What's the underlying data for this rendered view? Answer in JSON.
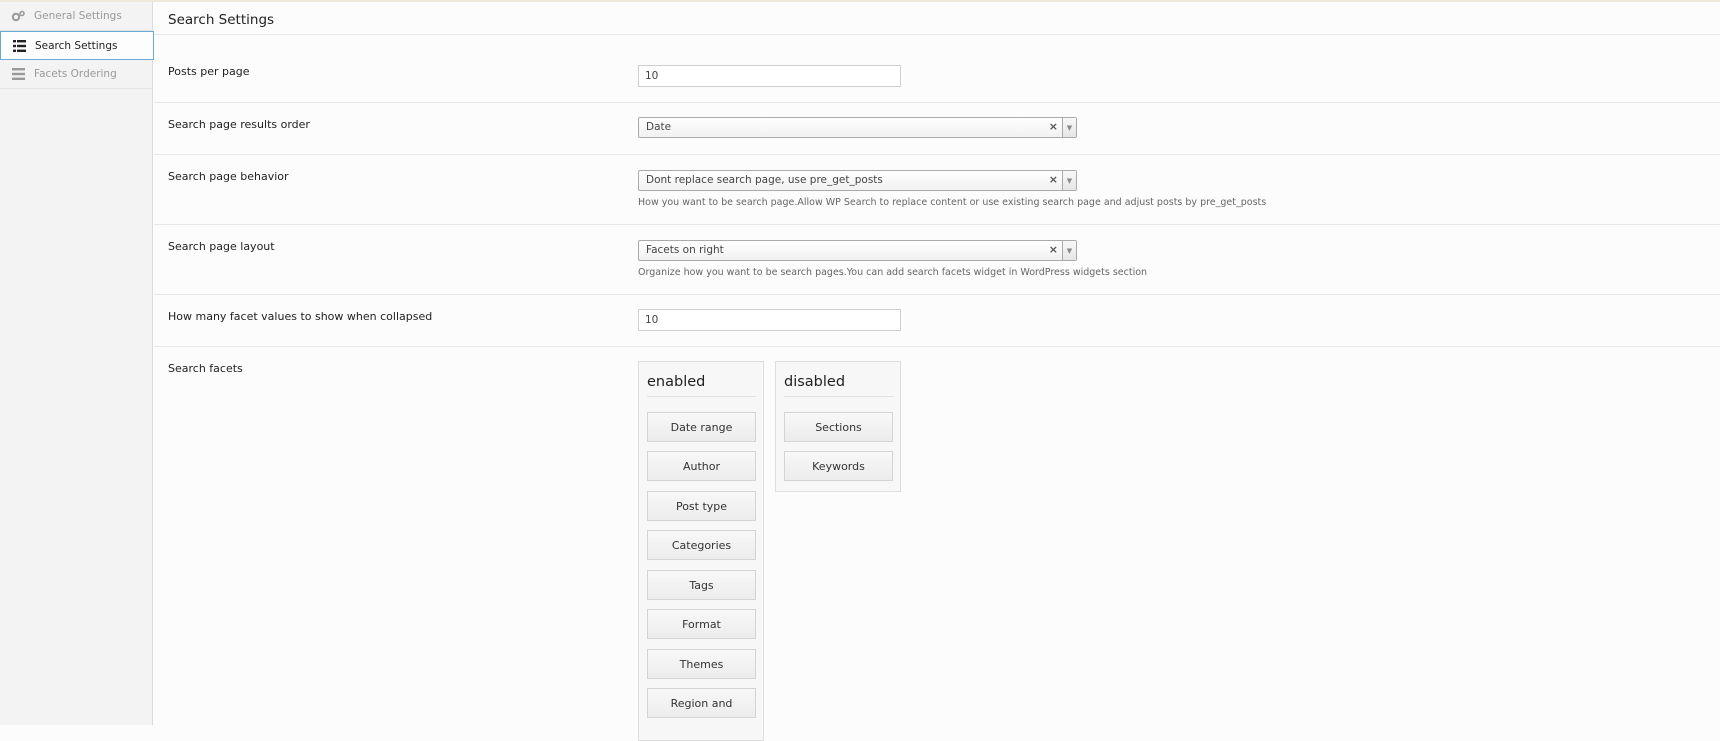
{
  "sidebar": {
    "items": [
      {
        "label": "General Settings",
        "icon": "gears-icon",
        "active": false
      },
      {
        "label": "Search Settings",
        "icon": "list-icon",
        "active": true
      },
      {
        "label": "Facets Ordering",
        "icon": "menu-icon",
        "active": false
      }
    ]
  },
  "page": {
    "title": "Search Settings"
  },
  "fields": {
    "posts_per_page": {
      "label": "Posts per page",
      "value": "10"
    },
    "results_order": {
      "label": "Search page results order",
      "value": "Date"
    },
    "behavior": {
      "label": "Search page behavior",
      "value": "Dont replace search page, use pre_get_posts",
      "help": "How you want to be search page.Allow WP Search to replace content or use existing search page and adjust posts by pre_get_posts"
    },
    "layout": {
      "label": "Search page layout",
      "value": "Facets on right",
      "help": "Organize how you want to be search pages.You can add search facets widget in WordPress widgets section"
    },
    "facet_values": {
      "label": "How many facet values to show when collapsed",
      "value": "10"
    },
    "facets": {
      "label": "Search facets",
      "enabled_title": "enabled",
      "disabled_title": "disabled",
      "enabled": [
        "Date range",
        "Author",
        "Post type",
        "Categories",
        "Tags",
        "Format",
        "Themes",
        "Region and"
      ],
      "disabled": [
        "Sections",
        "Keywords"
      ]
    }
  },
  "select_clear_glyph": "×",
  "select_arrow_glyph": "▼",
  "colors": {
    "active_border": "#6aa9d8",
    "sidebar_bg": "#f3f3f3"
  }
}
